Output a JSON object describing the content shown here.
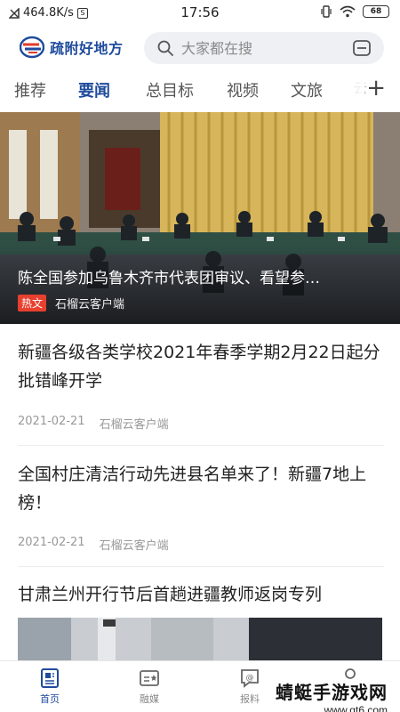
{
  "status_bar": {
    "net_speed": "464.8K/s",
    "time": "17:56",
    "battery": "68"
  },
  "header": {
    "app_name": "疏附好地方",
    "search_placeholder": "大家都在搜"
  },
  "tabs": [
    {
      "label": "推荐",
      "active": false
    },
    {
      "label": "要闻",
      "active": true
    },
    {
      "label": "总目标",
      "active": false
    },
    {
      "label": "视频",
      "active": false
    },
    {
      "label": "文旅",
      "active": false
    },
    {
      "label": "云",
      "active": false
    }
  ],
  "hero": {
    "title": "陈全国参加乌鲁木齐市代表团审议、看望参…",
    "tag": "热文",
    "source": "石榴云客户端"
  },
  "news": [
    {
      "title": "新疆各级各类学校2021年春季学期2月22日起分批错峰开学",
      "date": "2021-02-21",
      "source": "石榴云客户端"
    },
    {
      "title": "全国村庄清洁行动先进县名单来了！新疆7地上榜！",
      "date": "2021-02-21",
      "source": "石榴云客户端"
    },
    {
      "title": "甘肃兰州开行节后首趟进疆教师返岗专列"
    }
  ],
  "bottom_nav": [
    {
      "label": "首页",
      "icon": "news-icon",
      "active": true
    },
    {
      "label": "融媒",
      "icon": "media-card-icon",
      "active": false
    },
    {
      "label": "报料",
      "icon": "report-chat-icon",
      "active": false
    }
  ],
  "watermark": {
    "title": "蜻蜓手游戏网",
    "url": "www.qt6.com"
  },
  "colors": {
    "brand": "#1f4b9c",
    "hot_tag": "#e7402f"
  }
}
